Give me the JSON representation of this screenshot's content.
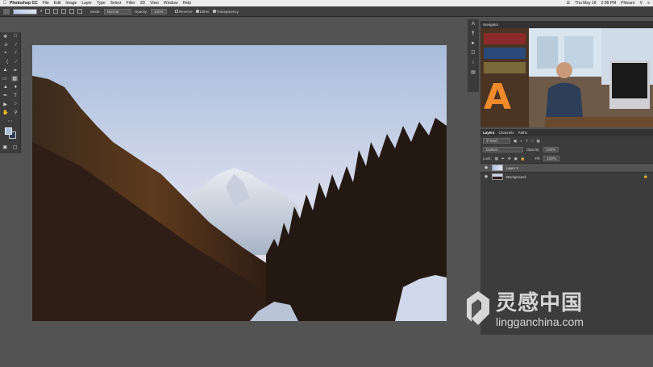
{
  "menubar": {
    "app": "Photoshop CC",
    "items": [
      "File",
      "Edit",
      "Image",
      "Layer",
      "Type",
      "Select",
      "Filter",
      "3D",
      "View",
      "Window",
      "Help"
    ],
    "status": [
      "Thu May 18",
      "2:08 PM",
      "Phlearn"
    ]
  },
  "options": {
    "mode_label": "Mode:",
    "mode_value": "Normal",
    "opacity_label": "Opacity:",
    "opacity_value": "100%",
    "reverse": "Reverse",
    "dither": "Dither",
    "transparency": "Transparency"
  },
  "navigator": {
    "title": "Navigator"
  },
  "layers": {
    "tabs": [
      "Layers",
      "Channels",
      "Paths"
    ],
    "kind": "Kind",
    "blend_mode": "Darken",
    "opacity_label": "Opacity:",
    "opacity_value": "100%",
    "lock_label": "Lock:",
    "fill_label": "Fill:",
    "fill_value": "100%",
    "items": [
      {
        "name": "Layer 1"
      },
      {
        "name": "Background"
      }
    ]
  },
  "watermark": {
    "cn": "灵感中国",
    "en": "lingganchina.com"
  },
  "colors": {
    "fg": "#a8bfdc",
    "bg": "#2c3e5a",
    "ui": "#535353"
  }
}
